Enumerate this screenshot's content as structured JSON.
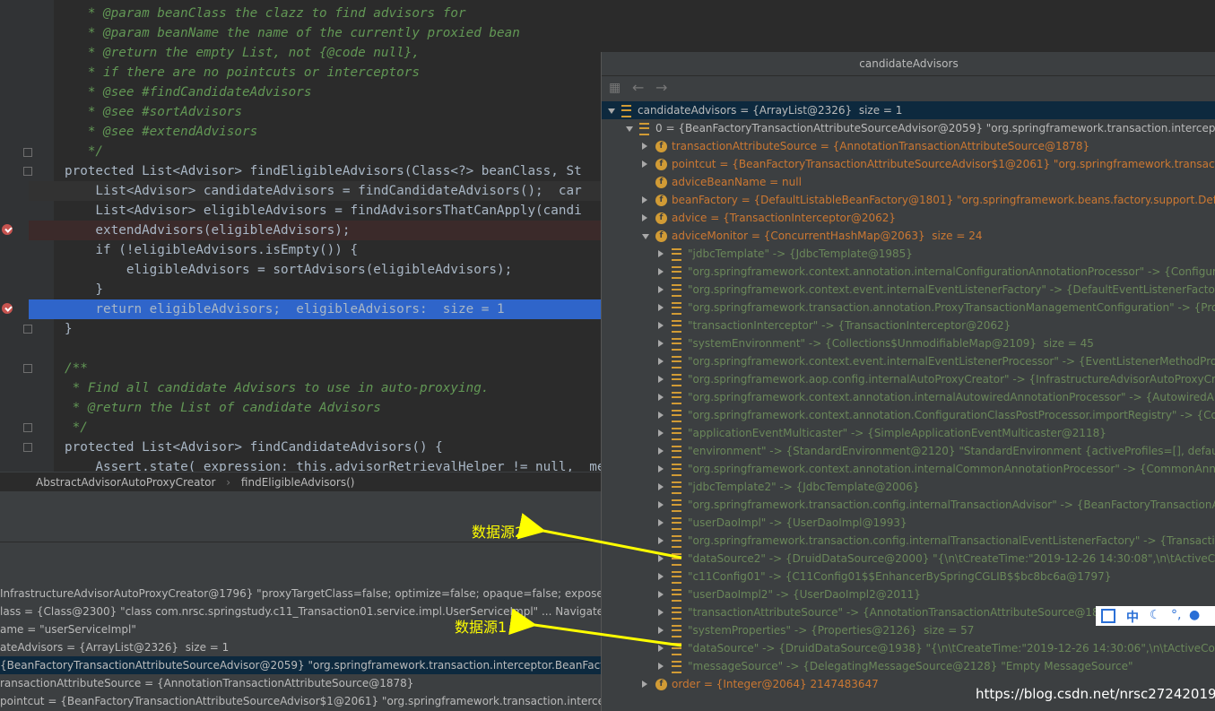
{
  "editor": {
    "lines": [
      {
        "cls": "cmt",
        "text": "   * @param beanClass the clazz to find advisors for"
      },
      {
        "cls": "cmt",
        "text": "   * @param beanName the name of the currently proxied bean"
      },
      {
        "cls": "cmt",
        "text": "   * @return the empty List, not {@code null},"
      },
      {
        "cls": "cmt",
        "text": "   * if there are no pointcuts or interceptors"
      },
      {
        "cls": "cmt",
        "text": "   * @see #findCandidateAdvisors"
      },
      {
        "cls": "cmt",
        "text": "   * @see #sortAdvisors"
      },
      {
        "cls": "cmt",
        "text": "   * @see #extendAdvisors"
      },
      {
        "cls": "cmt",
        "text": "   */"
      },
      {
        "cls": "",
        "text": "protected List<Advisor> findEligibleAdvisors(Class<?> beanClass, St"
      },
      {
        "cls": "",
        "text": "    List<Advisor> candidateAdvisors = findCandidateAdvisors();  car"
      },
      {
        "cls": "",
        "text": "    List<Advisor> eligibleAdvisors = findAdvisorsThatCanApply(candi"
      },
      {
        "cls": "",
        "text": "    extendAdvisors(eligibleAdvisors);"
      },
      {
        "cls": "",
        "text": "    if (!eligibleAdvisors.isEmpty()) {"
      },
      {
        "cls": "",
        "text": "        eligibleAdvisors = sortAdvisors(eligibleAdvisors);"
      },
      {
        "cls": "",
        "text": "    }"
      },
      {
        "cls": "",
        "text": "    return eligibleAdvisors;  eligibleAdvisors:  size = 1"
      },
      {
        "cls": "",
        "text": "}"
      },
      {
        "cls": "",
        "text": ""
      },
      {
        "cls": "cmt",
        "text": "/**"
      },
      {
        "cls": "cmt",
        "text": " * Find all candidate Advisors to use in auto-proxying."
      },
      {
        "cls": "cmt",
        "text": " * @return the List of candidate Advisors"
      },
      {
        "cls": "cmt",
        "text": " */"
      },
      {
        "cls": "",
        "text": "protected List<Advisor> findCandidateAdvisors() {"
      },
      {
        "cls": "",
        "text": "    Assert.state( expression: this.advisorRetrievalHelper != null,  me"
      }
    ]
  },
  "breadcrumb": {
    "class": "AbstractAdvisorAutoProxyCreator",
    "method": "findEligibleAdvisors()",
    "sep": "›"
  },
  "lower_vars": [
    "InfrastructureAdvisorAutoProxyCreator@1796} \"proxyTargetClass=false; optimize=false; opaque=false; exposeProx",
    "lass = {Class@2300} \"class com.nrsc.springstudy.c11_Transaction01.service.impl.UserServiceImpl\" ... Navigate",
    "ame = \"userServiceImpl\"",
    "ateAdvisors = {ArrayList@2326}  size = 1",
    "{BeanFactoryTransactionAttributeSourceAdvisor@2059} \"org.springframework.transaction.interceptor.BeanFactoryT",
    "ransactionAttributeSource = {AnnotationTransactionAttributeSource@1878}",
    "pointcut = {BeanFactoryTransactionAttributeSourceAdvisor$1@2061} \"org.springframework.transaction.interceptor.B",
    "dviceBeanName = null"
  ],
  "popup": {
    "title": "candidateAdvisors",
    "rows": [
      "candidateAdvisors = {ArrayList@2326}  size = 1",
      "0 = {BeanFactoryTransactionAttributeSourceAdvisor@2059} \"org.springframework.transaction.interceptor.Be",
      "transactionAttributeSource = {AnnotationTransactionAttributeSource@1878}",
      "pointcut = {BeanFactoryTransactionAttributeSourceAdvisor$1@2061} \"org.springframework.transaction.in",
      "adviceBeanName = null",
      "beanFactory = {DefaultListableBeanFactory@1801} \"org.springframework.beans.factory.support.DefaultLi",
      "advice = {TransactionInterceptor@2062}",
      "adviceMonitor = {ConcurrentHashMap@2063}  size = 24",
      "\"jdbcTemplate\" -> {JdbcTemplate@1985}",
      "\"org.springframework.context.annotation.internalConfigurationAnnotationProcessor\" -> {Configuratio",
      "\"org.springframework.context.event.internalEventListenerFactory\" -> {DefaultEventListenerFactory@210",
      "\"org.springframework.transaction.annotation.ProxyTransactionManagementConfiguration\" -> {ProxyTr",
      "\"transactionInterceptor\" -> {TransactionInterceptor@2062}",
      "\"systemEnvironment\" -> {Collections$UnmodifiableMap@2109}  size = 45",
      "\"org.springframework.context.event.internalEventListenerProcessor\" -> {EventListenerMethodProcesso",
      "\"org.springframework.aop.config.internalAutoProxyCreator\" -> {InfrastructureAdvisorAutoProxyCreato",
      "\"org.springframework.context.annotation.internalAutowiredAnnotationProcessor\" -> {AutowiredAnnot",
      "\"org.springframework.context.annotation.ConfigurationClassPostProcessor.importRegistry\" -> {Config",
      "\"applicationEventMulticaster\" -> {SimpleApplicationEventMulticaster@2118}",
      "\"environment\" -> {StandardEnvironment@2120} \"StandardEnvironment {activeProfiles=[], defaultProfil",
      "\"org.springframework.context.annotation.internalCommonAnnotationProcessor\" -> {CommonAnnotati",
      "\"jdbcTemplate2\" -> {JdbcTemplate@2006}",
      "\"org.springframework.transaction.config.internalTransactionAdvisor\" -> {BeanFactoryTransactionAttrib",
      "\"userDaoImpl\" -> {UserDaoImpl@1993}",
      "\"org.springframework.transaction.config.internalTransactionalEventListenerFactory\" -> {TransactionalE",
      "\"dataSource2\" -> {DruidDataSource@2000} \"{\\n\\tCreateTime:\"2019-12-26 14:30:08\",\\n\\tActiveCount:0,\\",
      "\"c11Config01\" -> {C11Config01$$EnhancerBySpringCGLIB$$bc8bc6a@1797}",
      "\"userDaoImpl2\" -> {UserDaoImpl2@2011}",
      "\"transactionAttributeSource\" -> {AnnotationTransactionAttributeSource@1878}",
      "\"systemProperties\" -> {Properties@2126}  size = 57",
      "\"dataSource\" -> {DruidDataSource@1938} \"{\\n\\tCreateTime:\"2019-12-26 14:30:06\",\\n\\tActiveCount:0,\\n",
      "\"messageSource\" -> {DelegatingMessageSource@2128} \"Empty MessageSource\"",
      "order = {Integer@2064} 2147483647"
    ]
  },
  "annotations": {
    "label1": "数据源2",
    "label2": "数据源1"
  },
  "ime": {
    "text": "中"
  },
  "watermark": "https://blog.csdn.net/nrsc272420199"
}
